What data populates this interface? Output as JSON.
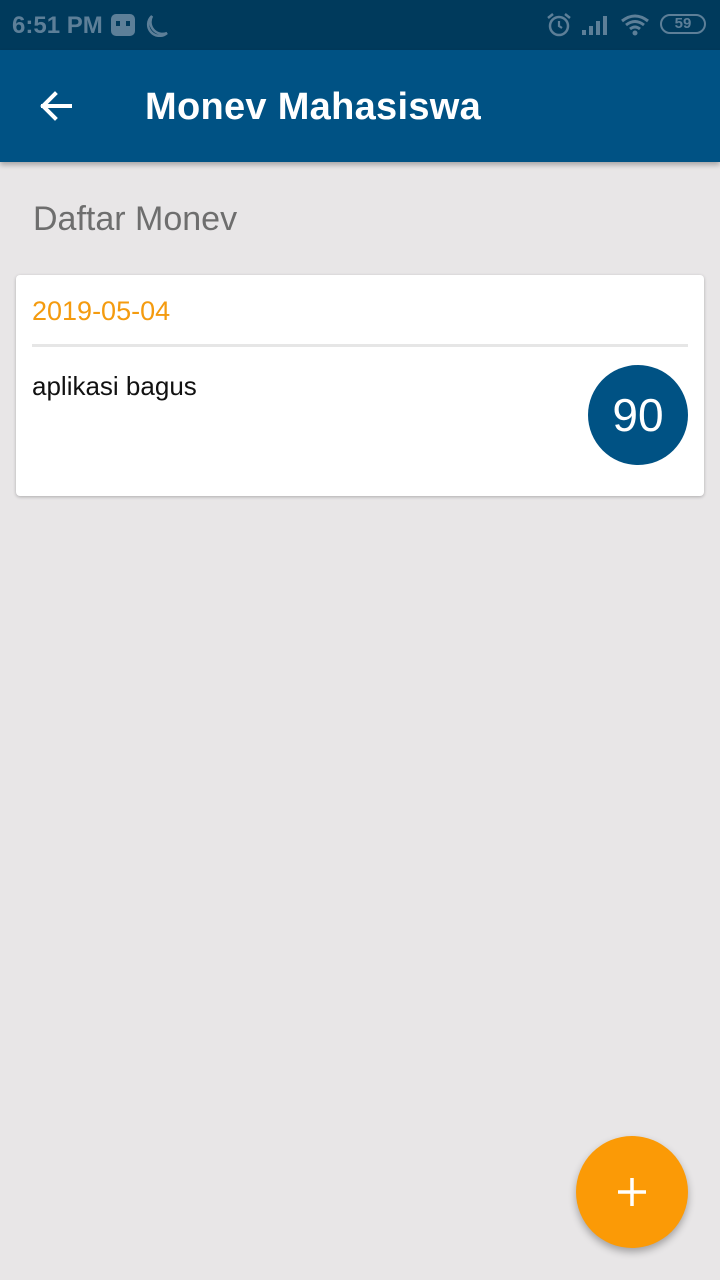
{
  "status_bar": {
    "time": "6:51 PM",
    "battery": "59",
    "icons": [
      "app-notification-icon",
      "moon-icon",
      "alarm-icon",
      "signal-icon",
      "wifi-icon",
      "battery-icon"
    ]
  },
  "app_bar": {
    "title": "Monev Mahasiswa",
    "back_icon": "arrow-left-icon",
    "color": "#005284"
  },
  "main": {
    "section_title": "Daftar Monev",
    "items": [
      {
        "date": "2019-05-04",
        "comment": "aplikasi bagus",
        "score": "90"
      }
    ]
  },
  "fab": {
    "icon": "plus-icon",
    "color": "#fb9a06"
  },
  "colors": {
    "primary": "#005284",
    "status_bar": "#003a5c",
    "accent": "#fb9a06",
    "date_text": "#f49b0f",
    "background": "#e8e6e7"
  }
}
